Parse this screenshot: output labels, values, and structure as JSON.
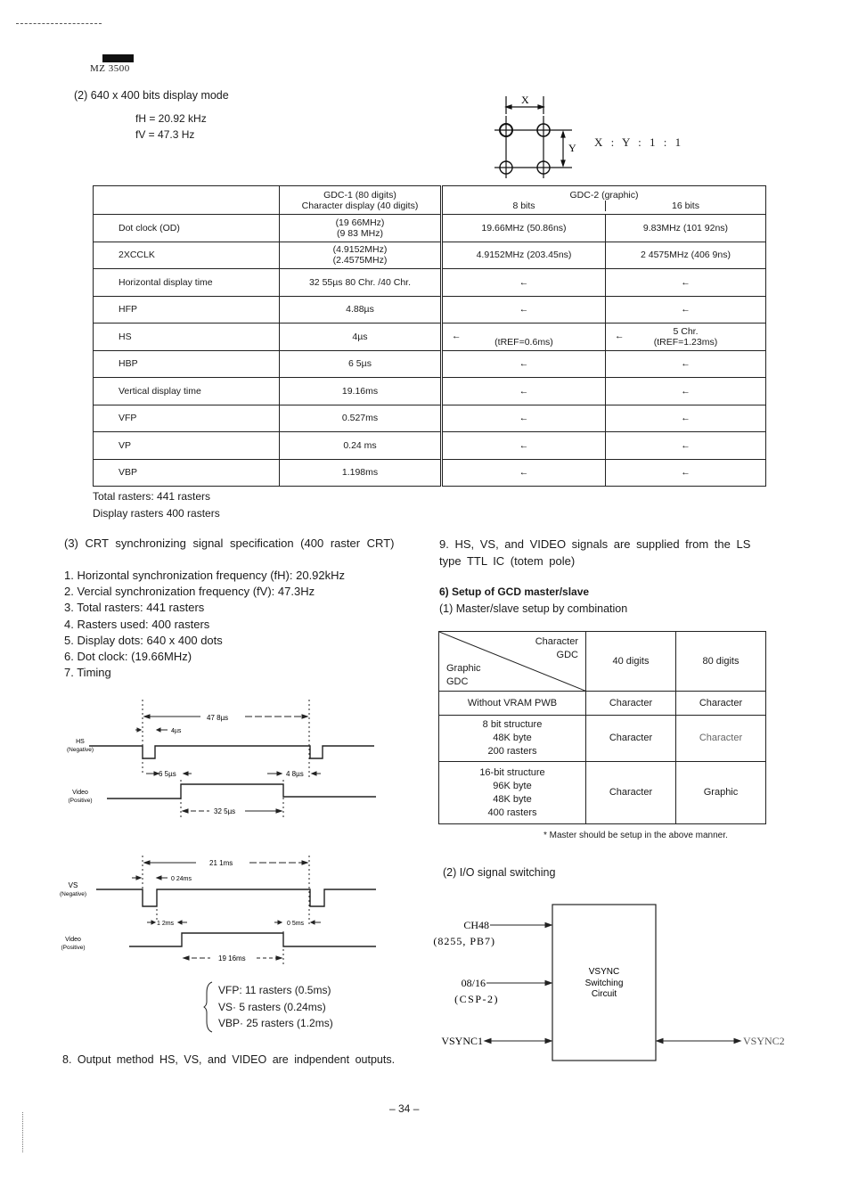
{
  "header": {
    "model": "MZ 3500"
  },
  "display_mode": {
    "title": "(2) 640 x 400 bits display mode",
    "fH": "fH = 20.92 kHz",
    "fV": "fV = 47.3   Hz"
  },
  "pixel_diagram": {
    "x_label": "X",
    "y_label": "Y",
    "ratio": "X : Y : 1 : 1"
  },
  "timing_table": {
    "header": {
      "gdc1_line1": "GDC-1 (80 digits)",
      "gdc1_line2": "Character display (40 digits)",
      "gdc2": "GDC-2 (graphic)",
      "bits8": "8 bits",
      "bits16": "16 bits"
    },
    "rows": [
      {
        "label": "Dot clock (OD)",
        "gdc1": [
          "(19 66MHz)",
          "(9 83  MHz)"
        ],
        "bits8": "19.66MHz (50.86ns)",
        "bits16": "9.83MHz (101 92ns)"
      },
      {
        "label": "2XCCLK",
        "gdc1": [
          "(4.9152MHz)",
          "(2.4575MHz)"
        ],
        "bits8": "4.9152MHz (203.45ns)",
        "bits16": "2 4575MHz (406 9ns)"
      },
      {
        "label": "Horizontal display time",
        "gdc1": [
          "32 55µs  80 Chr. /40 Chr."
        ],
        "bits8": "←",
        "bits16": "←"
      },
      {
        "label": "HFP",
        "gdc1": [
          "4.88µs"
        ],
        "bits8": "←",
        "bits16": "←"
      },
      {
        "label": "HS",
        "gdc1": [
          "4µs"
        ],
        "bits8_arrow": "←",
        "bits8": "(tREF=0.6ms)",
        "bits16_arrow": "←",
        "bits16_line1": "5 Chr.",
        "bits16": "(tREF=1.23ms)"
      },
      {
        "label": "HBP",
        "gdc1": [
          "6 5µs"
        ],
        "bits8": "←",
        "bits16": "←"
      },
      {
        "label": "Vertical display time",
        "gdc1": [
          "19.16ms"
        ],
        "bits8": "←",
        "bits16": "←"
      },
      {
        "label": "VFP",
        "gdc1": [
          "0.527ms"
        ],
        "bits8": "←",
        "bits16": "←"
      },
      {
        "label": "VP",
        "gdc1": [
          "0.24  ms"
        ],
        "bits8": "←",
        "bits16": "←"
      },
      {
        "label": "VBP",
        "gdc1": [
          "1.198ms"
        ],
        "bits8": "←",
        "bits16": "←"
      }
    ],
    "total_rasters": "Total rasters: 441 rasters",
    "display_rasters": "Display rasters  400 rasters"
  },
  "crt_spec": {
    "title": "(3)  CRT  synchronizing  signal  specification  (400  raster CRT)",
    "items": [
      "1. Horizontal synchronization frequency (fH): 20.92kHz",
      "2. Vercial synchronization frequency (fV): 47.3Hz",
      "3. Total rasters: 441 rasters",
      "4. Rasters used: 400 rasters",
      "5. Display dots: 640 x 400 dots",
      "6. Dot clock: (19.66MHz)",
      "7. Timing"
    ]
  },
  "hs_timing": {
    "period": "47 8µs",
    "pulse": "4µs",
    "hs_label": [
      "HS",
      "(Negative)"
    ],
    "video_label": [
      "Video",
      "(Positive)"
    ],
    "back_porch": "6 5µs",
    "front_porch": "4 8µs",
    "active": "32 5µs"
  },
  "vs_timing": {
    "period": "21 1ms",
    "pulse": "0 24ms",
    "vs_label": [
      "VS",
      "(Negative)"
    ],
    "video_label": [
      "Video",
      "(Positive)"
    ],
    "back_porch": "1 2ms",
    "front_porch": "0 5ms",
    "active": "19 16ms"
  },
  "vertical_rasters": [
    "VFP: 11 rasters (0.5ms)",
    "VS·    5 rasters (0.24ms)",
    "VBP· 25 rasters (1.2ms)"
  ],
  "item8": "8.  Output  method  HS,  VS,  and  VIDEO  are  indpendent outputs.",
  "item9": "9.  HS,  VS,  and  VIDEO  signals  are  supplied  from  the  LS type TTL IC (totem pole)",
  "section6": {
    "title": "6) Setup of GCD master/slave",
    "subtitle": "(1)  Master/slave setup by combination"
  },
  "master_slave_table": {
    "corner_top": [
      "Character",
      "GDC"
    ],
    "corner_bottom": [
      "Graphic",
      "GDC"
    ],
    "columns": [
      "40 digits",
      "80 digits"
    ],
    "rows": [
      {
        "label": [
          "Without VRAM PWB"
        ],
        "c40": "Character",
        "c80": "Character"
      },
      {
        "label": [
          "8 bit structure",
          "48K byte",
          "200 rasters"
        ],
        "c40": "Character",
        "c80": "Character"
      },
      {
        "label": [
          "16-bit structure",
          "96K byte",
          "48K byte",
          "400 rasters"
        ],
        "c40": "Character",
        "c80": "Graphic"
      }
    ],
    "note": "* Master should be setup in the above manner."
  },
  "io_switching": {
    "title": "(2)  I/O signal switching",
    "box_label": [
      "VSYNC",
      "Switching",
      "Circuit"
    ],
    "inputs": [
      {
        "name": "CH48",
        "sub": "(8255, PB7)"
      },
      {
        "name": "08/16",
        "sub": "(CSP-2)"
      },
      {
        "name": "VSYNC1",
        "sub": ""
      }
    ],
    "output": "VSYNC2"
  },
  "footer": {
    "page_number": "– 34 –"
  }
}
